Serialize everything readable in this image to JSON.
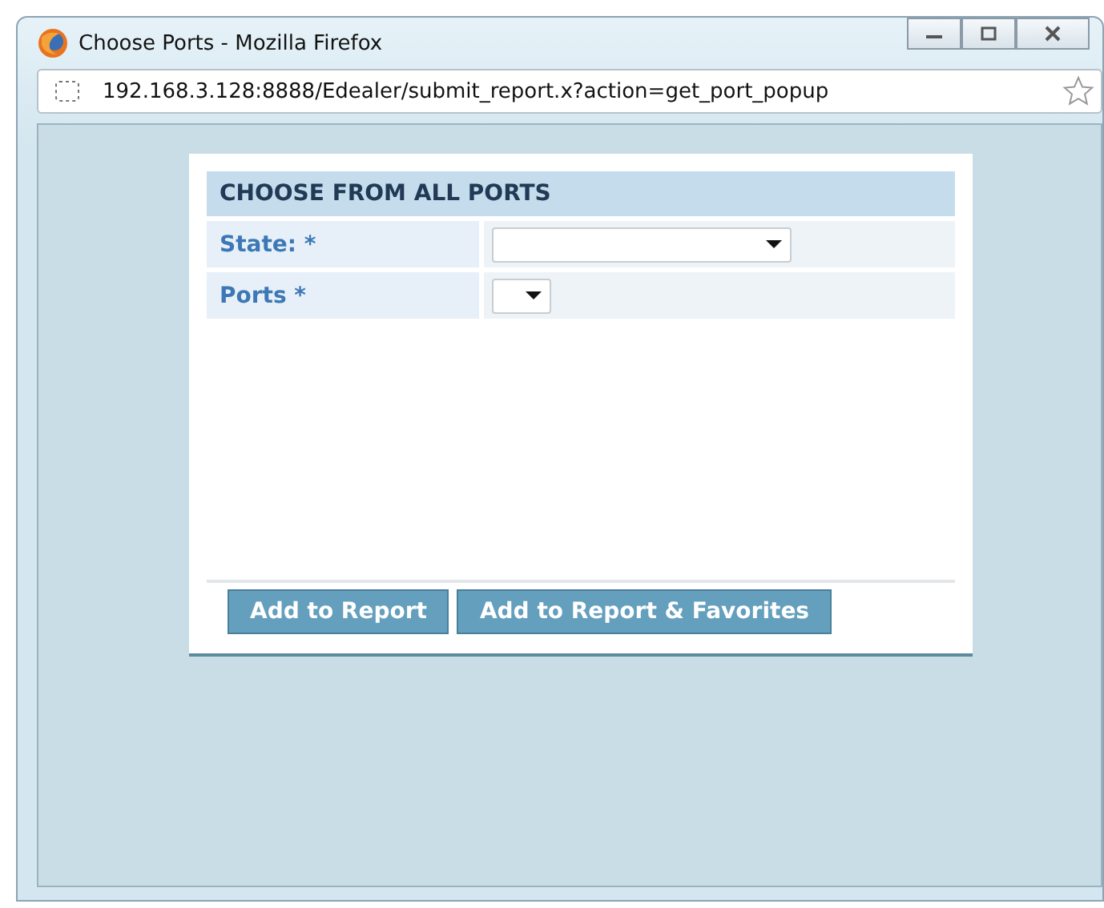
{
  "window": {
    "title": "Choose Ports - Mozilla Firefox"
  },
  "address_bar": {
    "url": "192.168.3.128:8888/Edealer/submit_report.x?action=get_port_popup"
  },
  "form": {
    "heading": "CHOOSE FROM ALL PORTS",
    "fields": [
      {
        "label": "State: *",
        "kind": "wide"
      },
      {
        "label": "Ports *",
        "kind": "narrow"
      }
    ],
    "buttons": [
      "Add to Report",
      "Add to Report & Favorites"
    ]
  }
}
